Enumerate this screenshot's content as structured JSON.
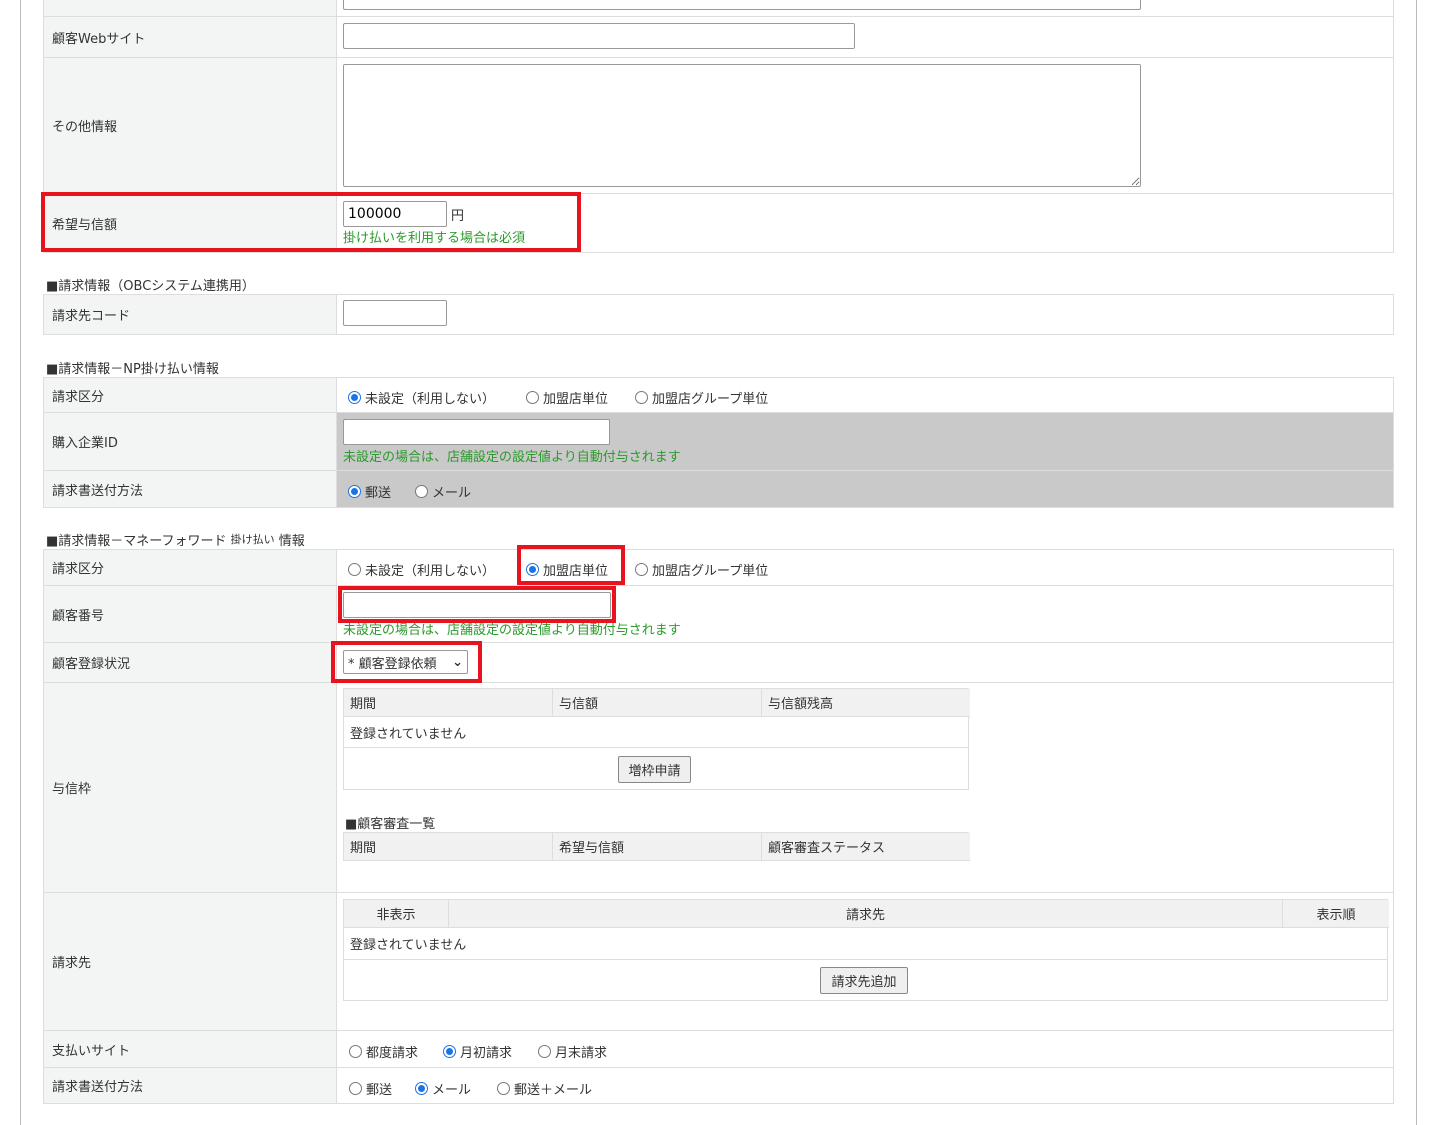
{
  "web_site": {
    "label": "顧客Webサイト",
    "value": ""
  },
  "other_info": {
    "label": "その他情報",
    "value": ""
  },
  "desired_credit": {
    "label": "希望与信額",
    "value": "100000",
    "unit": "円",
    "note": "掛け払いを利用する場合は必須"
  },
  "obc": {
    "heading": "■請求情報（OBCシステム連携用）",
    "billing_code_label": "請求先コード",
    "billing_code_value": ""
  },
  "np": {
    "heading": "■請求情報－NP掛け払い情報",
    "billing_type_label": "請求区分",
    "billing_type_options": [
      "未設定（利用しない）",
      "加盟店単位",
      "加盟店グループ単位"
    ],
    "billing_type_selected": 0,
    "company_id_label": "購入企業ID",
    "company_id_value": "",
    "company_id_note": "未設定の場合は、店舗設定の設定値より自動付与されます",
    "send_label": "請求書送付方法",
    "send_options": [
      "郵送",
      "メール"
    ],
    "send_selected": 0
  },
  "mf": {
    "heading": "■請求情報－マネーフォワード",
    "heading_small": "掛け払い",
    "heading_tail": "情報",
    "billing_type_label": "請求区分",
    "billing_type_options": [
      "未設定（利用しない）",
      "加盟店単位",
      "加盟店グループ単位"
    ],
    "billing_type_selected": 1,
    "customer_no_label": "顧客番号",
    "customer_no_value": "",
    "customer_no_note": "未設定の場合は、店舗設定の設定値より自動付与されます",
    "reg_status_label": "顧客登録状況",
    "reg_status_value": "* 顧客登録依頼",
    "credit_label": "与信枠",
    "credit_headers": [
      "期間",
      "与信額",
      "与信額残高"
    ],
    "credit_empty": "登録されていません",
    "credit_button": "増枠申請",
    "review_heading": "■顧客審査一覧",
    "review_headers": [
      "期間",
      "希望与信額",
      "顧客審査ステータス"
    ],
    "billto_label": "請求先",
    "billto_headers": [
      "非表示",
      "請求先",
      "表示順"
    ],
    "billto_empty": "登録されていません",
    "billto_button": "請求先追加",
    "pay_site_label": "支払いサイト",
    "pay_site_options": [
      "都度請求",
      "月初請求",
      "月末請求"
    ],
    "pay_site_selected": 1,
    "send_label": "請求書送付方法",
    "send_options": [
      "郵送",
      "メール",
      "郵送＋メール"
    ],
    "send_selected": 1
  },
  "colors": {
    "highlight": "#e8131f",
    "note": "#2a9a2a",
    "radio": "#1a73e8"
  }
}
